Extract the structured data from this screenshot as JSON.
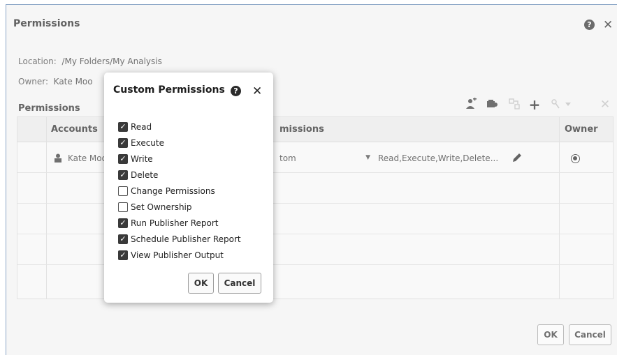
{
  "dialog": {
    "title": "Permissions",
    "location_label": "Location:",
    "location_value": "/My Folders/My Analysis",
    "owner_label": "Owner:",
    "owner_value": "Kate Moo",
    "section_label": "Permissions",
    "help_icon": "?",
    "close_icon": "✕"
  },
  "toolbar": {
    "icons": [
      "add-user-icon",
      "add-role-icon",
      "copy-icon",
      "add-icon",
      "set-permission-dropdown-icon",
      "delete-icon"
    ]
  },
  "table": {
    "headers": [
      "Accounts",
      "Permissions",
      "Owner"
    ],
    "header_permissions_visible": "missions",
    "rows": [
      {
        "account": "Kate Moo",
        "permission_select": "tom",
        "permission_detail": "Read,Execute,Write,Delete...",
        "owner_selected": true
      }
    ]
  },
  "footer": {
    "ok_label": "OK",
    "cancel_label": "Cancel"
  },
  "popup": {
    "title": "Custom Permissions",
    "help_icon": "?",
    "close_icon": "✕",
    "options": [
      {
        "label": "Read",
        "checked": true
      },
      {
        "label": "Execute",
        "checked": true
      },
      {
        "label": "Write",
        "checked": true
      },
      {
        "label": "Delete",
        "checked": true
      },
      {
        "label": "Change Permissions",
        "checked": false
      },
      {
        "label": "Set Ownership",
        "checked": false
      },
      {
        "label": "Run Publisher Report",
        "checked": true
      },
      {
        "label": "Schedule Publisher Report",
        "checked": true
      },
      {
        "label": "View Publisher Output",
        "checked": true
      }
    ],
    "ok_label": "OK",
    "cancel_label": "Cancel"
  }
}
